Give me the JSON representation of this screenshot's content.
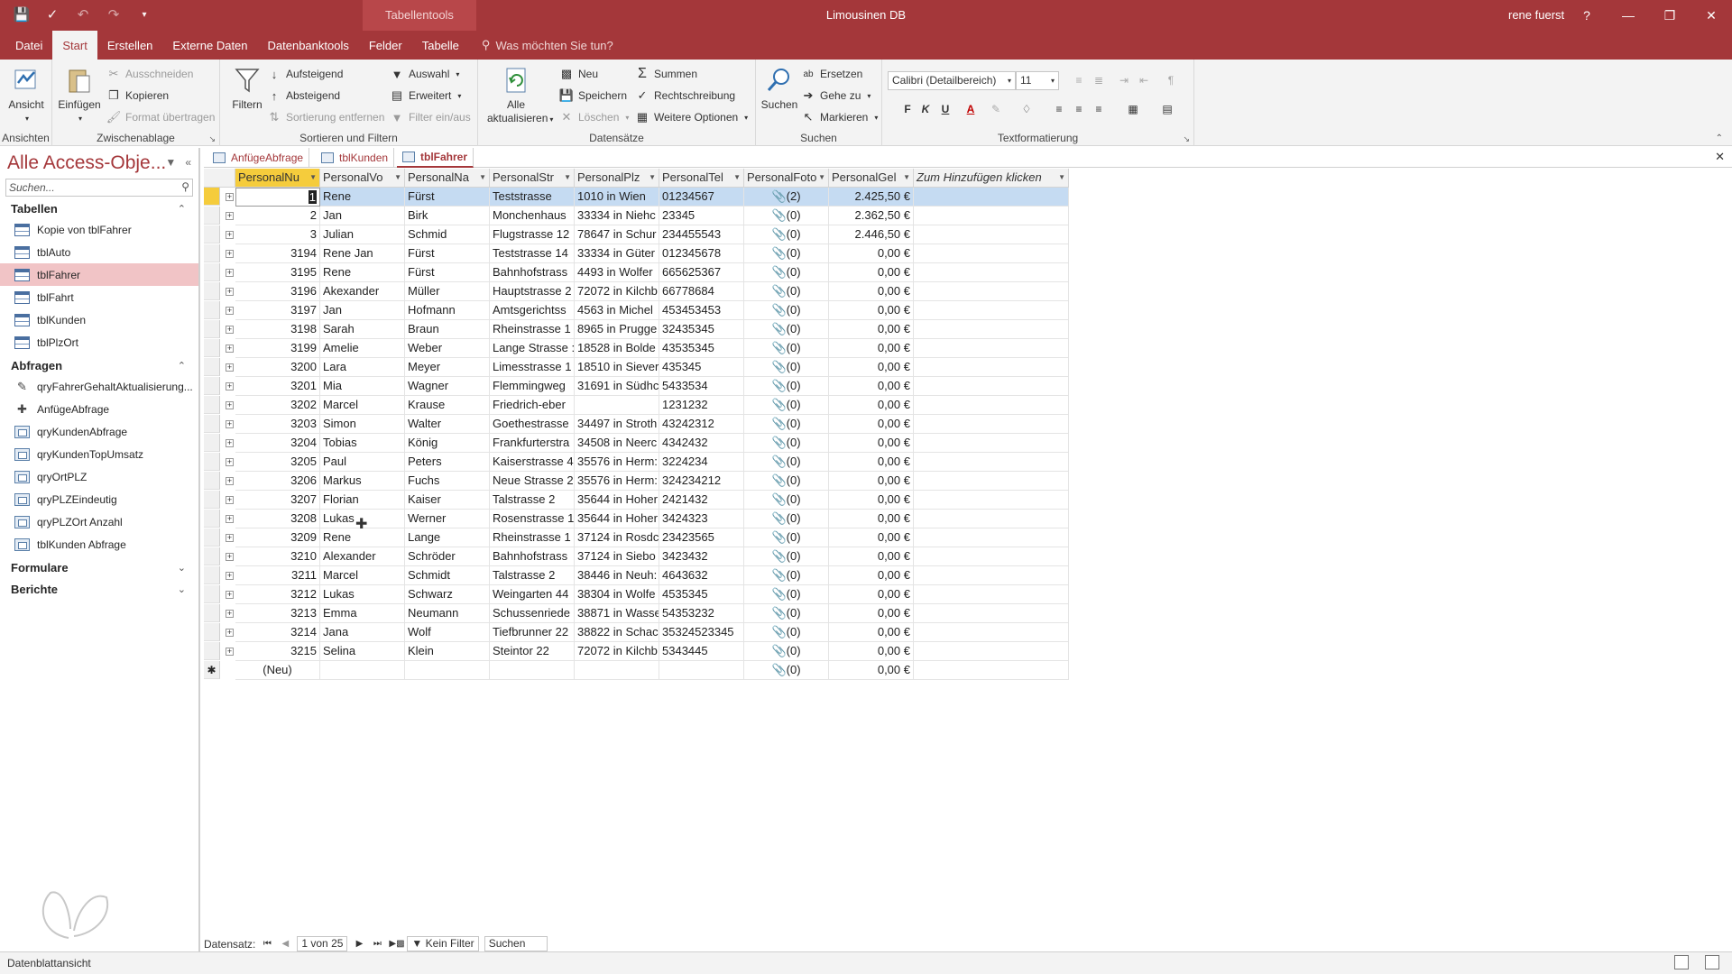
{
  "app": {
    "title": "Limousinen DB",
    "context_tab": "Tabellentools",
    "user": "rene fuerst",
    "help": "?"
  },
  "ribbon_tabs": [
    "Datei",
    "Start",
    "Erstellen",
    "Externe Daten",
    "Datenbanktools",
    "Felder",
    "Tabelle"
  ],
  "tell_me": "Was möchten Sie tun?",
  "ribbon": {
    "ansichten": {
      "label": "Ansichten",
      "ansicht": "Ansicht"
    },
    "zwischenablage": {
      "label": "Zwischenablage",
      "einfuegen": "Einfügen",
      "ausschneiden": "Ausschneiden",
      "kopieren": "Kopieren",
      "format": "Format übertragen"
    },
    "sortieren": {
      "label": "Sortieren und Filtern",
      "filtern": "Filtern",
      "aufsteigend": "Aufsteigend",
      "absteigend": "Absteigend",
      "sortierung": "Sortierung entfernen",
      "auswahl": "Auswahl",
      "erweitert": "Erweitert",
      "filter_einaus": "Filter ein/aus"
    },
    "datensaetze": {
      "label": "Datensätze",
      "alle": "Alle",
      "aktualisieren": "aktualisieren",
      "neu": "Neu",
      "speichern": "Speichern",
      "loeschen": "Löschen",
      "summen": "Summen",
      "rechtschreibung": "Rechtschreibung",
      "weitere": "Weitere Optionen"
    },
    "suchen": {
      "label": "Suchen",
      "suchen": "Suchen",
      "ersetzen": "Ersetzen",
      "gehe_zu": "Gehe zu",
      "markieren": "Markieren"
    },
    "textformatierung": {
      "label": "Textformatierung",
      "font": "Calibri (Detailbereich)",
      "size": "11",
      "bold": "F",
      "italic": "K",
      "underline": "U"
    }
  },
  "nav": {
    "title": "Alle Access-Obje...",
    "search_placeholder": "Suchen...",
    "sections": [
      {
        "label": "Tabellen",
        "items": [
          "Kopie von tblFahrer",
          "tblAuto",
          "tblFahrer",
          "tblFahrt",
          "tblKunden",
          "tblPlzOrt"
        ]
      },
      {
        "label": "Abfragen",
        "items": [
          "qryFahrerGehaltAktualisierung...",
          "AnfügeAbfrage",
          "qryKundenAbfrage",
          "qryKundenTopUmsatz",
          "qryOrtPLZ",
          "qryPLZEindeutig",
          "qryPLZOrt Anzahl",
          "tblKunden Abfrage"
        ]
      },
      {
        "label": "Formulare",
        "items": []
      },
      {
        "label": "Berichte",
        "items": []
      }
    ]
  },
  "doc_tabs": [
    "AnfügeAbfrage",
    "tblKunden",
    "tblFahrer"
  ],
  "table": {
    "columns": [
      "PersonalNu",
      "PersonalVo",
      "PersonalNa",
      "PersonalStr",
      "PersonalPlz",
      "PersonalTel",
      "PersonalFoto",
      "PersonalGel",
      "Zum Hinzufügen klicken"
    ],
    "rows": [
      [
        "1",
        "Rene",
        "Fürst",
        "Teststrasse",
        "1010 in Wien",
        "01234567",
        "(2)",
        "2.425,50 €"
      ],
      [
        "2",
        "Jan",
        "Birk",
        "Monchenhaus",
        "33334 in Niehc",
        "23345",
        "(0)",
        "2.362,50 €"
      ],
      [
        "3",
        "Julian",
        "Schmid",
        "Flugstrasse 12",
        "78647 in Schur",
        "234455543",
        "(0)",
        "2.446,50 €"
      ],
      [
        "3194",
        "Rene Jan",
        "Fürst",
        "Teststrasse 14",
        "33334 in Güter",
        "012345678",
        "(0)",
        "0,00 €"
      ],
      [
        "3195",
        "Rene",
        "Fürst",
        "Bahnhofstrass",
        "4493 in Wolfer",
        "665625367",
        "(0)",
        "0,00 €"
      ],
      [
        "3196",
        "Akexander",
        "Müller",
        "Hauptstrasse 2",
        "72072 in Kilchb",
        "66778684",
        "(0)",
        "0,00 €"
      ],
      [
        "3197",
        "Jan",
        "Hofmann",
        "Amtsgerichtss",
        "4563 in Michel",
        "453453453",
        "(0)",
        "0,00 €"
      ],
      [
        "3198",
        "Sarah",
        "Braun",
        "Rheinstrasse 1",
        "8965 in Prugge",
        "32435345",
        "(0)",
        "0,00 €"
      ],
      [
        "3199",
        "Amelie",
        "Weber",
        "Lange Strasse :",
        "18528 in Bolde",
        "43535345",
        "(0)",
        "0,00 €"
      ],
      [
        "3200",
        "Lara",
        "Meyer",
        "Limesstrasse 1",
        "18510 in Siever",
        "435345",
        "(0)",
        "0,00 €"
      ],
      [
        "3201",
        "Mia",
        "Wagner",
        "Flemmingweg",
        "31691 in Südhc",
        "5433534",
        "(0)",
        "0,00 €"
      ],
      [
        "3202",
        "Marcel",
        "Krause",
        "Friedrich-eber",
        "",
        "1231232",
        "(0)",
        "0,00 €"
      ],
      [
        "3203",
        "Simon",
        "Walter",
        "Goethestrasse",
        "34497 in Stroth",
        "43242312",
        "(0)",
        "0,00 €"
      ],
      [
        "3204",
        "Tobias",
        "König",
        "Frankfurterstra",
        "34508 in Neerc",
        "4342432",
        "(0)",
        "0,00 €"
      ],
      [
        "3205",
        "Paul",
        "Peters",
        "Kaiserstrasse 4",
        "35576 in Herm:",
        "3224234",
        "(0)",
        "0,00 €"
      ],
      [
        "3206",
        "Markus",
        "Fuchs",
        "Neue Strasse 2",
        "35576 in Herm:",
        "324234212",
        "(0)",
        "0,00 €"
      ],
      [
        "3207",
        "Florian",
        "Kaiser",
        "Talstrasse 2",
        "35644 in Hoher",
        "2421432",
        "(0)",
        "0,00 €"
      ],
      [
        "3208",
        "Lukas",
        "Werner",
        "Rosenstrasse 1",
        "35644 in Hoher",
        "3424323",
        "(0)",
        "0,00 €"
      ],
      [
        "3209",
        "Rene",
        "Lange",
        "Rheinstrasse 1",
        "37124 in Rosdc",
        "23423565",
        "(0)",
        "0,00 €"
      ],
      [
        "3210",
        "Alexander",
        "Schröder",
        "Bahnhofstrass",
        "37124 in Siebo",
        "3423432",
        "(0)",
        "0,00 €"
      ],
      [
        "3211",
        "Marcel",
        "Schmidt",
        "Talstrasse 2",
        "38446 in Neuh:",
        "4643632",
        "(0)",
        "0,00 €"
      ],
      [
        "3212",
        "Lukas",
        "Schwarz",
        "Weingarten 44",
        "38304 in Wolfe",
        "4535345",
        "(0)",
        "0,00 €"
      ],
      [
        "3213",
        "Emma",
        "Neumann",
        "Schussenriede",
        "38871 in Wasse",
        "54353232",
        "(0)",
        "0,00 €"
      ],
      [
        "3214",
        "Jana",
        "Wolf",
        "Tiefbrunner 22",
        "38822 in Schacl",
        "35324523345",
        "(0)",
        "0,00 €"
      ],
      [
        "3215",
        "Selina",
        "Klein",
        "Steintor 22",
        "72072 in Kilchb",
        "5343445",
        "(0)",
        "0,00 €"
      ]
    ],
    "new_row": {
      "id": "(Neu)",
      "foto": "(0)",
      "gehalt": "0,00 €"
    }
  },
  "record_nav": {
    "label": "Datensatz:",
    "position": "1 von 25",
    "filter": "Kein Filter",
    "search": "Suchen"
  },
  "status": "Datenblattansicht",
  "colors": {
    "accent": "#a4373a",
    "selected_row": "#c5dbf2",
    "header_highlight": "#f5cc3c",
    "nav_selected": "#f1c4c6"
  }
}
